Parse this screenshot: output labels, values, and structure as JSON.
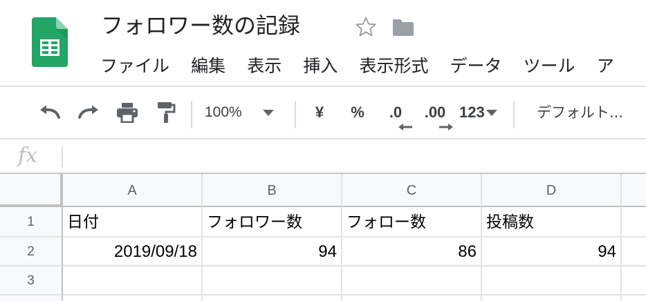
{
  "document": {
    "title": "フォロワー数の記録"
  },
  "menu": {
    "items": [
      "ファイル",
      "編集",
      "表示",
      "挿入",
      "表示形式",
      "データ",
      "ツール",
      "ア"
    ]
  },
  "toolbar": {
    "zoom": "100%",
    "currency": "¥",
    "percent": "%",
    "decrease_decimal": ".0",
    "increase_decimal": ".00",
    "more_formats": "123",
    "font": "デフォルト..."
  },
  "formula_bar": {
    "label": "fx",
    "value": ""
  },
  "sheet": {
    "columns": [
      "A",
      "B",
      "C",
      "D"
    ],
    "rows": [
      "1",
      "2",
      "3"
    ],
    "cells": {
      "A1": "日付",
      "B1": "フォロワー数",
      "C1": "フォロー数",
      "D1": "投稿数",
      "A2": "2019/09/18",
      "B2": "94",
      "C2": "86",
      "D2": "94"
    }
  },
  "colors": {
    "sheets_green": "#23a566",
    "header_bg": "#f8f9fa",
    "grid_line": "#e2e3e3",
    "icon_gray": "#5f6368"
  }
}
